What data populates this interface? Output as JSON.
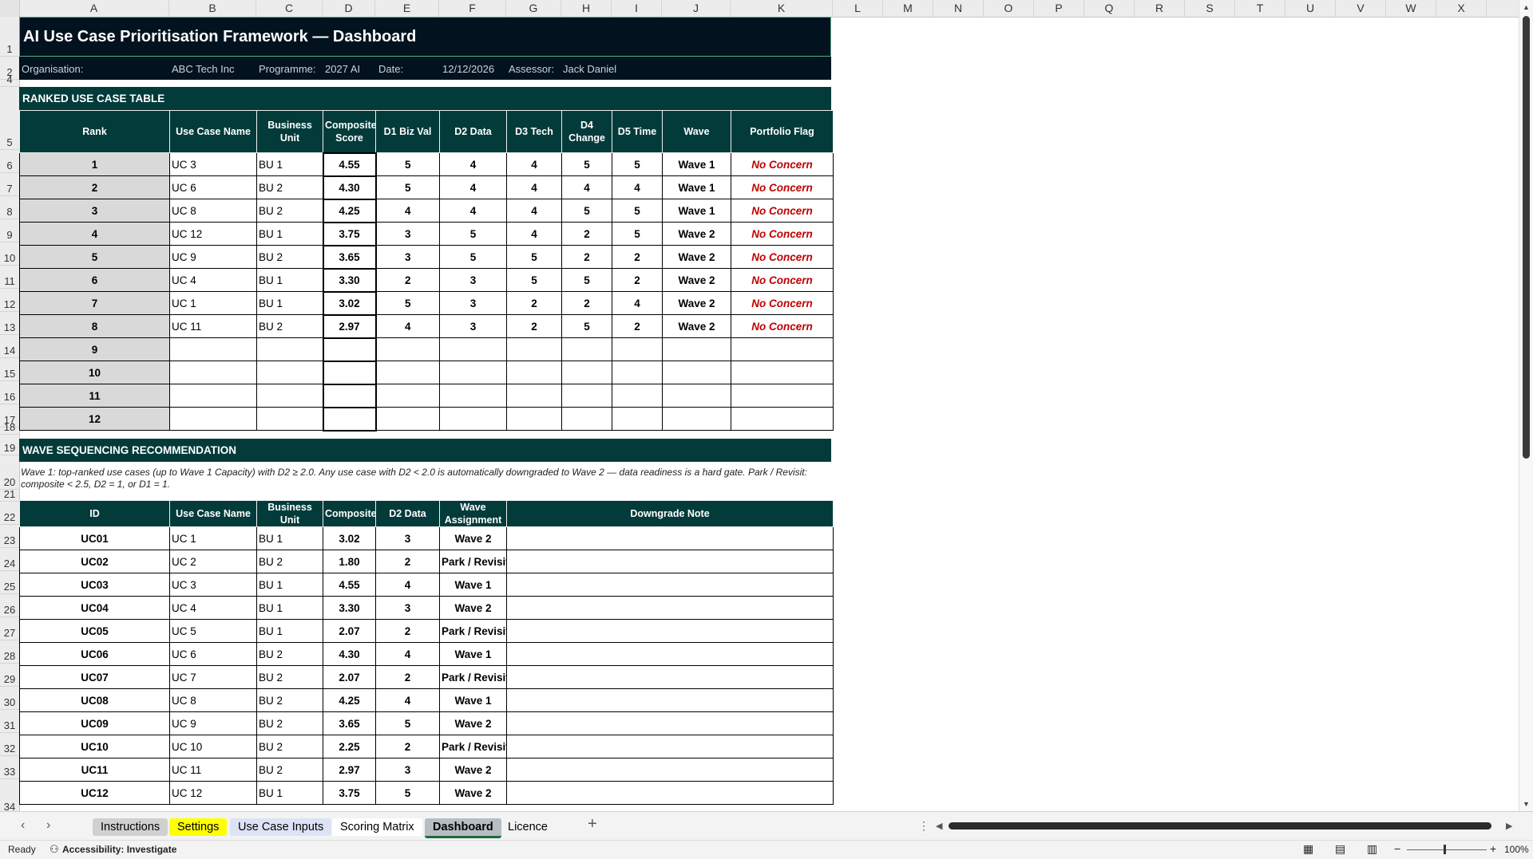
{
  "columns": [
    "A",
    "B",
    "C",
    "D",
    "E",
    "F",
    "G",
    "H",
    "I",
    "J",
    "K",
    "L",
    "M",
    "N",
    "O",
    "P",
    "Q",
    "R",
    "S",
    "T",
    "U",
    "V",
    "W",
    "X"
  ],
  "rows": [
    "1",
    "2",
    "4",
    "5",
    "6",
    "7",
    "8",
    "9",
    "10",
    "11",
    "12",
    "13",
    "14",
    "15",
    "16",
    "17",
    "18",
    "19",
    "20",
    "21",
    "22",
    "23",
    "24",
    "25",
    "26",
    "27",
    "28",
    "29",
    "30",
    "31",
    "32",
    "33",
    "34"
  ],
  "title": "AI Use Case Prioritisation Framework  —  Dashboard",
  "meta": {
    "org_label": "Organisation:",
    "org_value": "ABC Tech Inc",
    "prog_label": "Programme:",
    "prog_value": "2027 AI",
    "date_label": "Date:",
    "date_value": "12/12/2026",
    "assessor_label": "Assessor:",
    "assessor_value": "Jack Daniel"
  },
  "ranked": {
    "section_title": "RANKED USE CASE TABLE",
    "headers": [
      "Rank",
      "Use Case Name",
      "Business Unit",
      "Composite Score",
      "D1 Biz Val",
      "D2 Data",
      "D3 Tech",
      "D4 Change",
      "D5 Time",
      "Wave",
      "Portfolio Flag"
    ],
    "rows": [
      [
        "1",
        "UC 3",
        "BU 1",
        "4.55",
        "5",
        "4",
        "4",
        "5",
        "5",
        "Wave 1",
        "No Concern"
      ],
      [
        "2",
        "UC 6",
        "BU 2",
        "4.30",
        "5",
        "4",
        "4",
        "4",
        "4",
        "Wave 1",
        "No Concern"
      ],
      [
        "3",
        "UC 8",
        "BU 2",
        "4.25",
        "4",
        "4",
        "4",
        "5",
        "5",
        "Wave 1",
        "No Concern"
      ],
      [
        "4",
        "UC 12",
        "BU 1",
        "3.75",
        "3",
        "5",
        "4",
        "2",
        "5",
        "Wave 2",
        "No Concern"
      ],
      [
        "5",
        "UC 9",
        "BU 2",
        "3.65",
        "3",
        "5",
        "5",
        "2",
        "2",
        "Wave 2",
        "No Concern"
      ],
      [
        "6",
        "UC 4",
        "BU 1",
        "3.30",
        "2",
        "3",
        "5",
        "5",
        "2",
        "Wave 2",
        "No Concern"
      ],
      [
        "7",
        "UC 1",
        "BU 1",
        "3.02",
        "5",
        "3",
        "2",
        "2",
        "4",
        "Wave 2",
        "No Concern"
      ],
      [
        "8",
        "UC 11",
        "BU 2",
        "2.97",
        "4",
        "3",
        "2",
        "5",
        "2",
        "Wave 2",
        "No Concern"
      ],
      [
        "9",
        "",
        "",
        "",
        "",
        "",
        "",
        "",
        "",
        "",
        ""
      ],
      [
        "10",
        "",
        "",
        "",
        "",
        "",
        "",
        "",
        "",
        "",
        ""
      ],
      [
        "11",
        "",
        "",
        "",
        "",
        "",
        "",
        "",
        "",
        "",
        ""
      ],
      [
        "12",
        "",
        "",
        "",
        "",
        "",
        "",
        "",
        "",
        "",
        ""
      ]
    ]
  },
  "wave": {
    "section_title": "WAVE SEQUENCING RECOMMENDATION",
    "note": "Wave 1: top-ranked use cases (up to Wave 1 Capacity) with D2 ≥ 2.0.  Any use case with D2 < 2.0 is automatically downgraded to Wave 2 — data readiness is a hard gate.  Park / Revisit: composite < 2.5, D2 = 1, or D1 = 1.",
    "headers": [
      "ID",
      "Use Case Name",
      "Business Unit",
      "Composite",
      "D2 Data",
      "Wave Assignment",
      "Downgrade Note"
    ],
    "rows": [
      [
        "UC01",
        "UC 1",
        "BU 1",
        "3.02",
        "3",
        "Wave 2",
        ""
      ],
      [
        "UC02",
        "UC 2",
        "BU 2",
        "1.80",
        "2",
        "Park / Revisit",
        ""
      ],
      [
        "UC03",
        "UC 3",
        "BU 1",
        "4.55",
        "4",
        "Wave 1",
        ""
      ],
      [
        "UC04",
        "UC 4",
        "BU 1",
        "3.30",
        "3",
        "Wave 2",
        ""
      ],
      [
        "UC05",
        "UC 5",
        "BU 1",
        "2.07",
        "2",
        "Park / Revisit",
        ""
      ],
      [
        "UC06",
        "UC 6",
        "BU 2",
        "4.30",
        "4",
        "Wave 1",
        ""
      ],
      [
        "UC07",
        "UC 7",
        "BU 2",
        "2.07",
        "2",
        "Park / Revisit",
        ""
      ],
      [
        "UC08",
        "UC 8",
        "BU 2",
        "4.25",
        "4",
        "Wave 1",
        ""
      ],
      [
        "UC09",
        "UC 9",
        "BU 2",
        "3.65",
        "5",
        "Wave 2",
        ""
      ],
      [
        "UC10",
        "UC 10",
        "BU 2",
        "2.25",
        "2",
        "Park / Revisit",
        ""
      ],
      [
        "UC11",
        "UC 11",
        "BU 2",
        "2.97",
        "3",
        "Wave 2",
        ""
      ],
      [
        "UC12",
        "UC 12",
        "BU 1",
        "3.75",
        "5",
        "Wave 2",
        ""
      ]
    ]
  },
  "tabs": [
    {
      "label": "Instructions",
      "bg": "#d0d0d0",
      "color": "#000"
    },
    {
      "label": "Settings",
      "bg": "#ffff00",
      "color": "#000"
    },
    {
      "label": "Use Case Inputs",
      "bg": "#dde3f5",
      "color": "#000"
    },
    {
      "label": "Scoring Matrix",
      "bg": "#ffffff",
      "color": "#000"
    },
    {
      "label": "Dashboard",
      "bg": "#b7bdc4",
      "color": "#000",
      "active": true
    },
    {
      "label": "Licence",
      "bg": "transparent",
      "color": "#000"
    }
  ],
  "status": {
    "ready": "Ready",
    "accessibility": "Accessibility: Investigate",
    "zoom": "100%"
  },
  "icons": {
    "prev": "chevron-left-icon",
    "next": "chevron-right-icon",
    "add": "plus-icon"
  }
}
